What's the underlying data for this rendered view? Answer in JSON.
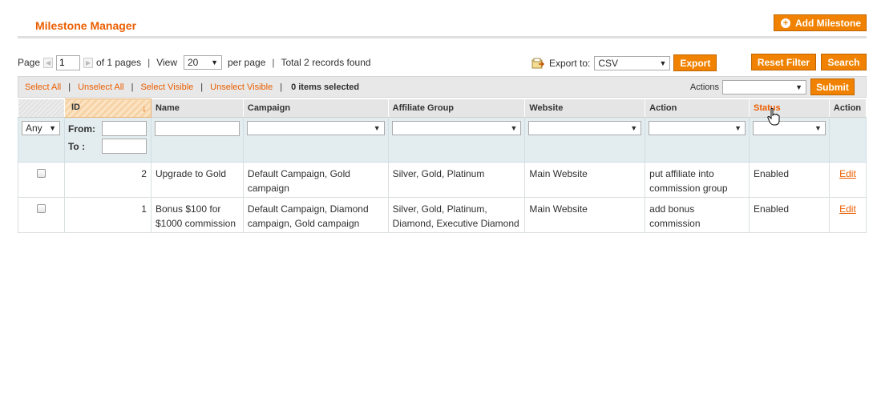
{
  "header": {
    "title": "Milestone Manager",
    "add_button": "Add Milestone"
  },
  "pager": {
    "page_label": "Page",
    "page_value": "1",
    "of_pages": "of 1 pages",
    "view_label": "View",
    "view_value": "20",
    "per_page": "per page",
    "total": "Total 2 records found"
  },
  "export": {
    "label": "Export to:",
    "format": "CSV",
    "button": "Export"
  },
  "buttons": {
    "reset_filter": "Reset Filter",
    "search": "Search",
    "submit": "Submit"
  },
  "massaction": {
    "select_all": "Select All",
    "unselect_all": "Unselect All",
    "select_visible": "Select Visible",
    "unselect_visible": "Unselect Visible",
    "selected": "0 items selected",
    "actions_label": "Actions",
    "actions_value": ""
  },
  "columns": [
    "ID",
    "Name",
    "Campaign",
    "Affiliate Group",
    "Website",
    "Action",
    "Status",
    "Action"
  ],
  "filters": {
    "massaction_any": "Any",
    "from_label": "From:",
    "to_label": "To :"
  },
  "rows": [
    {
      "id": "2",
      "name": "Upgrade to Gold",
      "campaign": "Default Campaign, Gold campaign",
      "group": "Silver, Gold, Platinum",
      "website": "Main Website",
      "action": "put affiliate into commission group",
      "status": "Enabled",
      "edit": "Edit"
    },
    {
      "id": "1",
      "name": "Bonus $100 for $1000 commission",
      "campaign": "Default Campaign, Diamond campaign, Gold campaign",
      "group": "Silver, Gold, Platinum, Diamond, Executive Diamond",
      "website": "Main Website",
      "action": "add bonus commission",
      "status": "Enabled",
      "edit": "Edit"
    }
  ],
  "colors": {
    "accent": "#eb5e00",
    "button": "#f18200"
  },
  "icons": {
    "add": "plus-circle-icon",
    "export": "export-icon",
    "sort": "sort-down-arrow-icon",
    "cursor": "hand-cursor-icon"
  }
}
